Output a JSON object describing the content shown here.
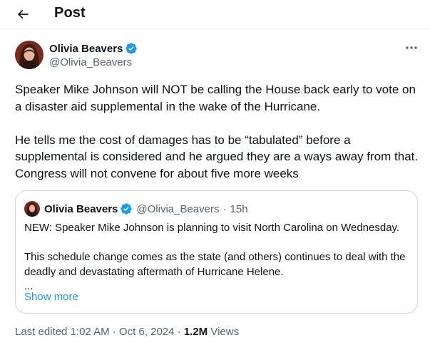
{
  "header": {
    "title": "Post",
    "back_icon": "arrow-left-icon"
  },
  "author": {
    "name": "Olivia Beavers",
    "handle": "@Olivia_Beavers",
    "verified_icon": "verified-badge-icon",
    "verified_color": "#1d9bf0"
  },
  "more_icon": "more-horizontal-icon",
  "tweet": {
    "text": "Speaker Mike Johnson will NOT be calling the House back early to vote on a disaster aid supplemental in the wake of the Hurricane.\n\nHe tells me the cost of damages has to be “tabulated” before a supplemental is considered and he argued they are a ways away from that. Congress will not convene for about five more weeks"
  },
  "quote": {
    "name": "Olivia Beavers",
    "handle": "@Olivia_Beavers",
    "separator": "·",
    "time": "15h",
    "text": "NEW: Speaker Mike Johnson is planning to visit North Carolina on Wednesday.\n\nThis schedule change comes as the state (and others) continues to deal with the deadly and devastating aftermath of Hurricane Helene.\n...",
    "show_more": "Show more"
  },
  "footer": {
    "edited": "Last edited 1:02 AM · Oct 6, 2024 ·",
    "views_count": "1.2M",
    "views_label": "Views"
  },
  "colors": {
    "text": "#0f1419",
    "secondary": "#536471",
    "accent": "#1d9bf0",
    "border": "#cfd9de"
  }
}
